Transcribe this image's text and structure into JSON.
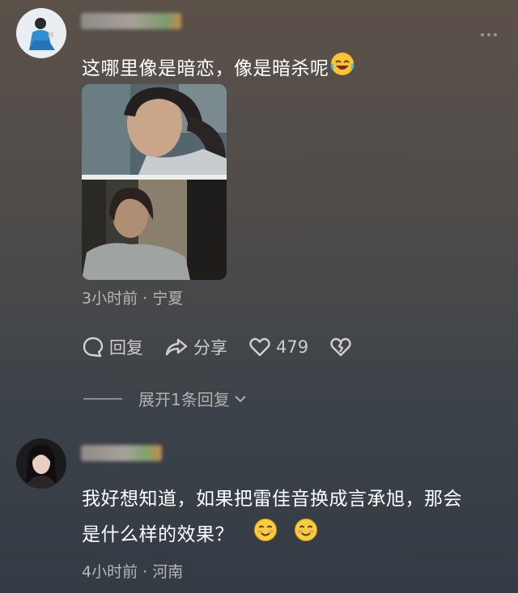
{
  "comments": [
    {
      "text": "这哪里像是暗恋，像是暗杀呢",
      "emoji": "rofl-emoji",
      "meta": "3小时前 · 宁夏",
      "actions": {
        "reply_label": "回复",
        "share_label": "分享",
        "like_count": "479"
      },
      "expand_label": "展开1条回复"
    },
    {
      "text_line1": "我好想知道，如果把雷佳音换成言承旭，那会",
      "text_line2": "是什么样的效果？",
      "emoji": "blush-emoji",
      "meta": "4小时前 · 河南"
    }
  ],
  "icons": [
    "more-icon",
    "reply-bubble-icon",
    "share-arrow-icon",
    "heart-icon",
    "broken-heart-icon",
    "chevron-down-icon"
  ],
  "colors": {
    "text": "#ffffff",
    "meta": "#b9b6b3",
    "action": "#cfcbc8"
  }
}
